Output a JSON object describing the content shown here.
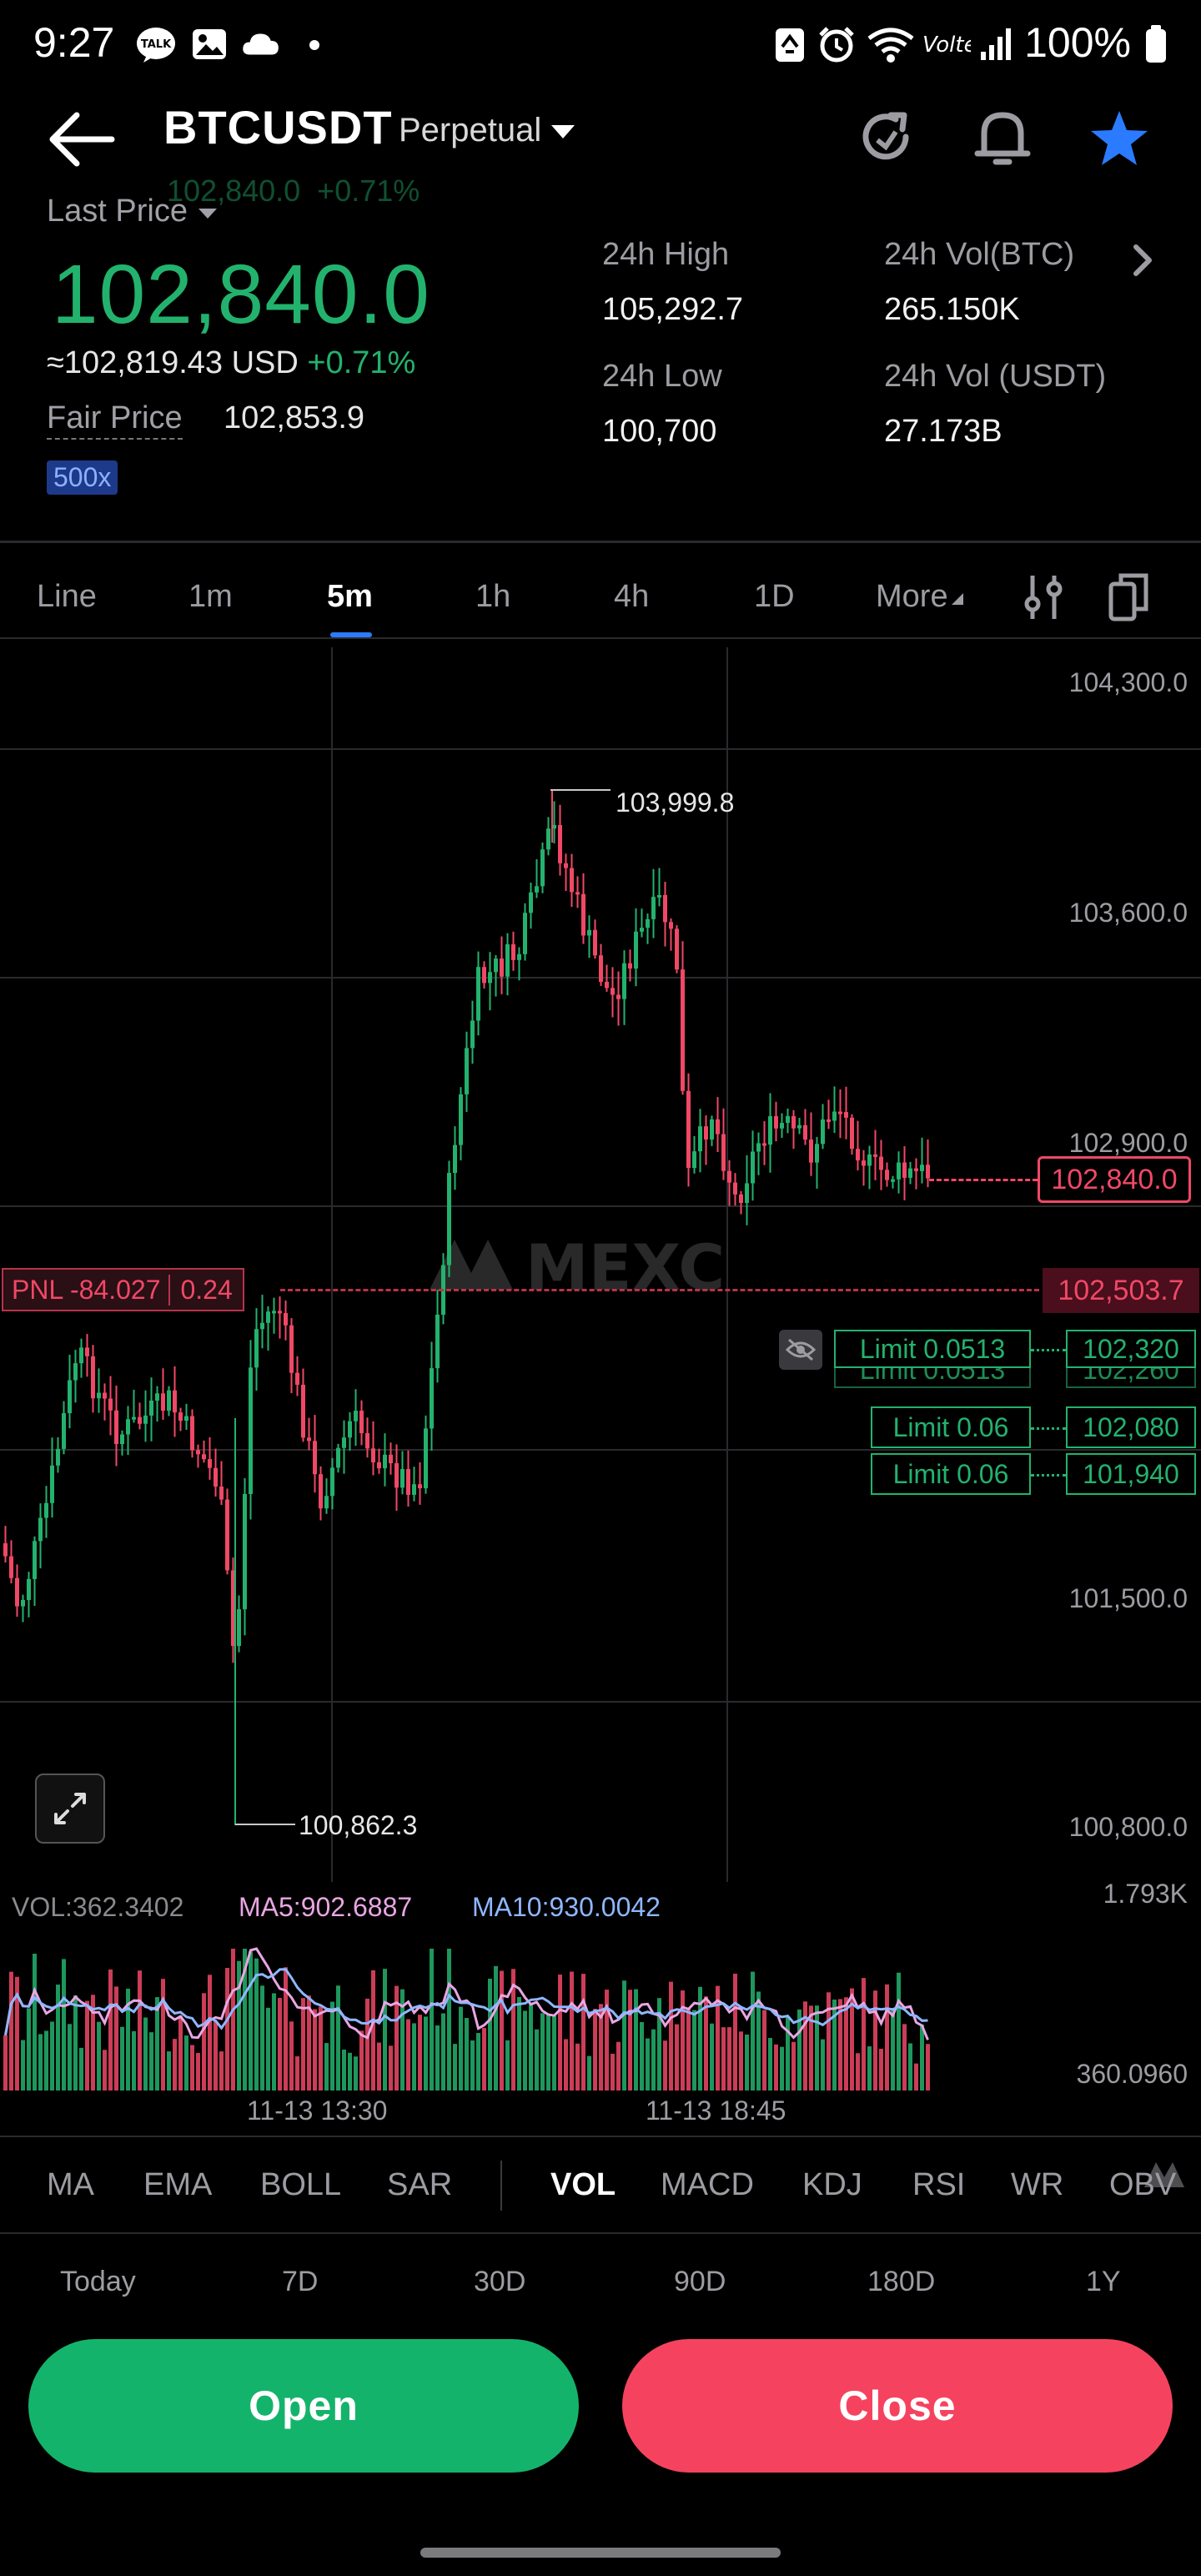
{
  "status_bar": {
    "time": "9:27",
    "battery": "100%"
  },
  "header": {
    "symbol": "BTCUSDT",
    "contract_type": "Perpetual",
    "ghost_price": "102,840.0",
    "ghost_change": "+0.71%"
  },
  "ticker": {
    "last_price_label": "Last Price",
    "last_price": "102,840.0",
    "usd_price": "≈102,819.43 USD",
    "change": "+0.71%",
    "fair_price_label": "Fair Price",
    "fair_price": "102,853.9",
    "leverage": "500x",
    "high_label": "24h High",
    "high": "105,292.7",
    "low_label": "24h Low",
    "low": "100,700",
    "vol_btc_label": "24h Vol(BTC)",
    "vol_btc": "265.150K",
    "vol_usdt_label": "24h Vol (USDT)",
    "vol_usdt": "27.173B"
  },
  "timeframes": [
    "Line",
    "1m",
    "5m",
    "1h",
    "4h",
    "1D",
    "More"
  ],
  "active_timeframe": "5m",
  "chart": {
    "price_axis": [
      "104,300.0",
      "103,600.0",
      "102,900.0",
      "101,500.0",
      "100,800.0"
    ],
    "high_marker": "103,999.8",
    "low_marker": "100,862.3",
    "current_price_tag": "102,840.0",
    "position_price_tag": "102,503.7",
    "pnl_label": "PNL -84.027",
    "pnl_qty": "0.24",
    "watermark": "MEXC",
    "orders": [
      {
        "label": "Limit 0.0513",
        "price": "102,320"
      },
      {
        "label": "Limit 0.0513",
        "price": "102,260"
      },
      {
        "label": "Limit 0.06",
        "price": "102,080"
      },
      {
        "label": "Limit 0.06",
        "price": "101,940"
      }
    ],
    "vol_label": "VOL:362.3402",
    "ma5_label": "MA5:902.6887",
    "ma10_label": "MA10:930.0042",
    "vol_axis_top": "1.793K",
    "vol_axis_bottom": "360.0960",
    "time_labels": [
      "11-13 13:30",
      "11-13 18:45"
    ],
    "colors": {
      "up": "#23b26d",
      "down": "#f04866",
      "ma5": "#e9a6e3",
      "ma10": "#8fb7ff"
    }
  },
  "indicators": [
    "MA",
    "EMA",
    "BOLL",
    "SAR",
    "VOL",
    "MACD",
    "KDJ",
    "RSI",
    "WR",
    "OBV"
  ],
  "active_indicator": "VOL",
  "periods": [
    "Today",
    "7D",
    "30D",
    "90D",
    "180D",
    "1Y"
  ],
  "buttons": {
    "open": "Open",
    "close": "Close"
  }
}
